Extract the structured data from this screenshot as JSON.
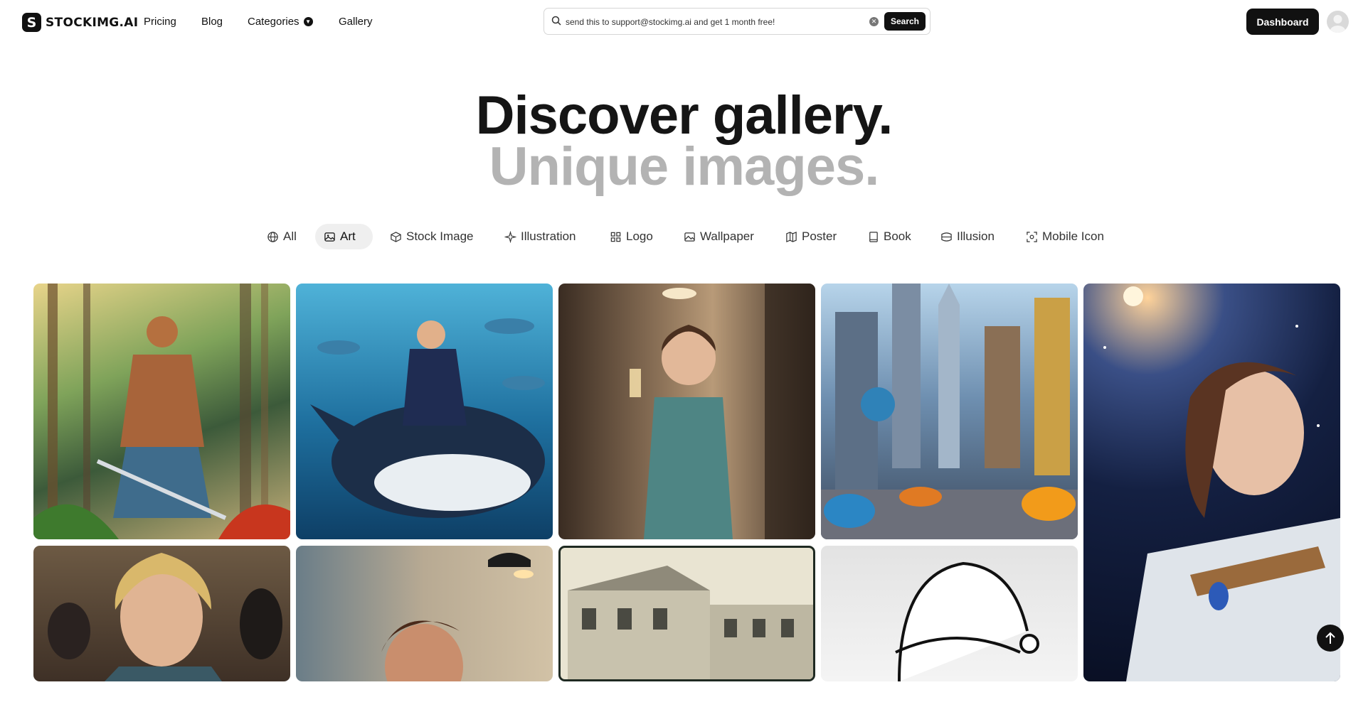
{
  "header": {
    "logo_text": "STOCKIMG.AI",
    "nav": {
      "pricing": "Pricing",
      "blog": "Blog",
      "categories": "Categories",
      "gallery": "Gallery"
    },
    "search": {
      "value": "send this to support@stockimg.ai and get 1 month free!",
      "button": "Search"
    },
    "dashboard_button": "Dashboard"
  },
  "hero": {
    "line1": "Discover gallery.",
    "line2": "Unique images."
  },
  "filters": [
    {
      "label": "All",
      "icon": "globe-icon"
    },
    {
      "label": "Art",
      "icon": "image-icon",
      "active": true
    },
    {
      "label": "Stock Image",
      "icon": "box-icon"
    },
    {
      "label": "Illustration",
      "icon": "sparkle-icon"
    },
    {
      "label": "Logo",
      "icon": "grid-icon"
    },
    {
      "label": "Wallpaper",
      "icon": "wallpaper-icon"
    },
    {
      "label": "Poster",
      "icon": "map-icon"
    },
    {
      "label": "Book",
      "icon": "book-icon"
    },
    {
      "label": "Illusion",
      "icon": "illusion-icon"
    },
    {
      "label": "Mobile Icon",
      "icon": "scan-icon"
    }
  ],
  "colors": {
    "accent": "#111111",
    "muted_heading": "#b3b3b3",
    "chip_active_bg": "#efefef"
  },
  "gallery": [
    {
      "subject": "warrior-forest"
    },
    {
      "subject": "man-riding-whale"
    },
    {
      "subject": "woman-kitchen"
    },
    {
      "subject": "futuristic-city"
    },
    {
      "subject": "space-woman"
    },
    {
      "subject": "blonde-woman-party"
    },
    {
      "subject": "man-restaurant"
    },
    {
      "subject": "vintage-building"
    },
    {
      "subject": "santa-hat-lineart"
    }
  ]
}
